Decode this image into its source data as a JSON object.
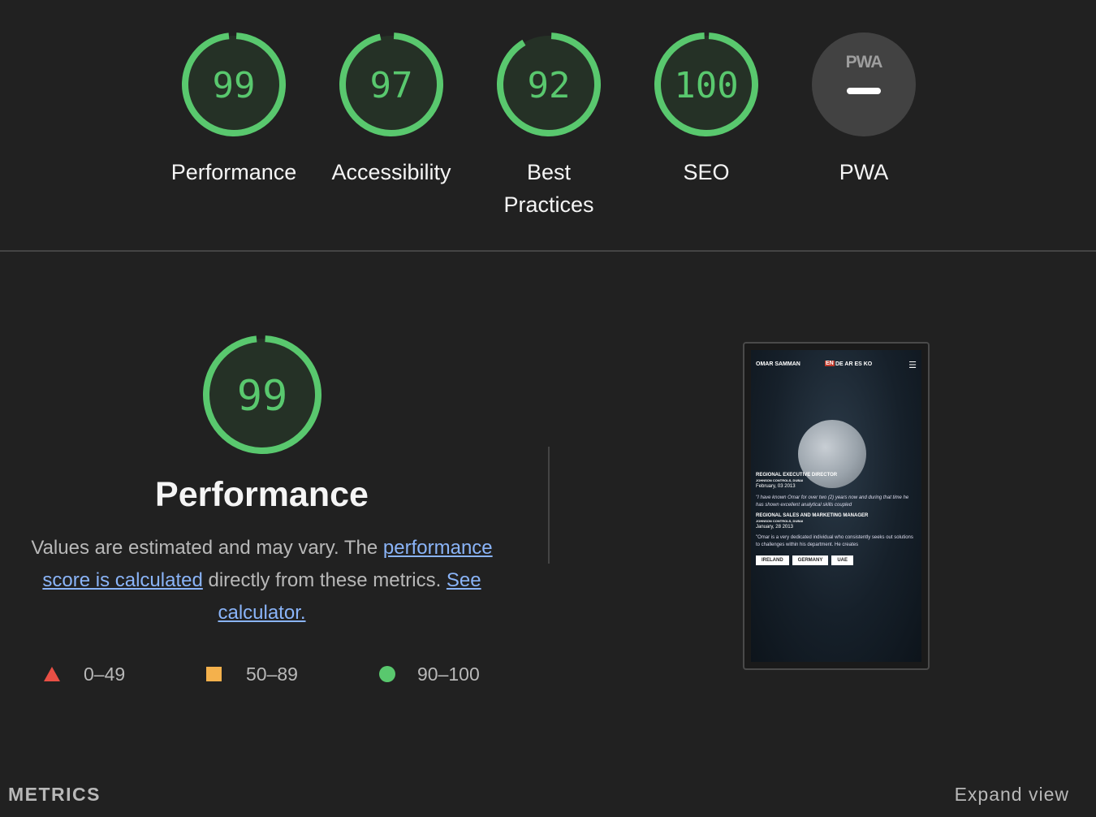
{
  "colors": {
    "background": "#212121",
    "pass": "#59c86e",
    "average": "#f4b14c",
    "fail": "#e94f45",
    "link": "#8ab4f8",
    "pwa_gray": "#424242"
  },
  "categories": [
    {
      "label": "Performance",
      "score": "99",
      "fraction": 0.99
    },
    {
      "label": "Accessibility",
      "score": "97",
      "fraction": 0.97
    },
    {
      "label": "Best",
      "label2": "Practices",
      "score": "92",
      "fraction": 0.92
    },
    {
      "label": "SEO",
      "score": "100",
      "fraction": 1.0
    },
    {
      "label": "PWA",
      "badge": "PWA",
      "icon": "pwa-dash-icon"
    }
  ],
  "performance": {
    "score": "99",
    "fraction": 0.99,
    "title": "Performance",
    "desc_prefix": "Values are estimated and may vary. The ",
    "link_score": "performance score is calculated",
    "desc_middle": " directly from these metrics. ",
    "link_calculator": "See calculator."
  },
  "legend": [
    {
      "icon": "fail-triangle-icon",
      "range": "0–49"
    },
    {
      "icon": "average-square-icon",
      "range": "50–89"
    },
    {
      "icon": "pass-circle-icon",
      "range": "90–100"
    }
  ],
  "screenshot": {
    "site_name": "OMAR SAMMAN",
    "lang_active": "EN",
    "langs": "DE AR ES KO",
    "items": [
      {
        "title": "REGIONAL EXECUTIVE DIRECTOR",
        "company": "JOHNSON CONTROLS, DUBAI",
        "date": "February, 03 2013",
        "quote": "\"I have known Omar for over two (2) years now and during that time he has shown excellent analytical skills coupled"
      },
      {
        "title": "REGIONAL SALES AND MARKETING MANAGER",
        "company": "JOHNSON CONTROLS, DUBAI",
        "date": "January, 28 2013",
        "quote": "\"Omar is a very dedicated individual who consistently seeks out solutions to challenges within his department. He creates"
      }
    ],
    "buttons": [
      "IRELAND",
      "GERMANY",
      "UAE"
    ]
  },
  "metrics": {
    "title": "METRICS",
    "expand": "Expand view"
  }
}
